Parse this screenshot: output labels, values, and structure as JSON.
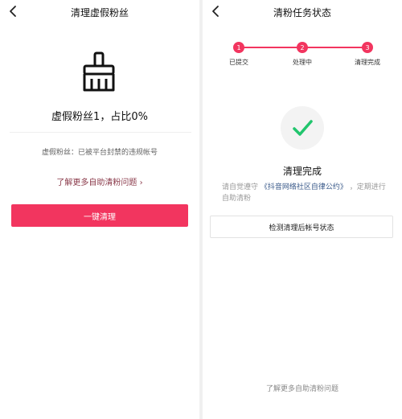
{
  "left": {
    "title": "清理虚假粉丝",
    "fake_count_text": "虚假粉丝1，占比0%",
    "fake_desc": "虚假粉丝：已被平台封禁的违规帐号",
    "learn_more": "了解更多自助清粉问题 ›",
    "clean_button": "一键清理"
  },
  "right": {
    "title": "清粉任务状态",
    "steps": [
      {
        "num": "1",
        "label": "已提交"
      },
      {
        "num": "2",
        "label": "处理中"
      },
      {
        "num": "3",
        "label": "清理完成"
      }
    ],
    "done_title": "清理完成",
    "rule_prefix": "请自觉遵守",
    "rule_link": "《抖音网络社区自律公约》",
    "rule_suffix": "，定期进行自助清粉",
    "check_button": "检测清理后帐号状态",
    "bottom_link": "了解更多自助清粉问题"
  },
  "colors": {
    "accent": "#f2355f",
    "check": "#21c56d"
  },
  "icons": {
    "back": "chevron-left-icon",
    "broom": "broom-icon",
    "check": "checkmark-icon"
  }
}
